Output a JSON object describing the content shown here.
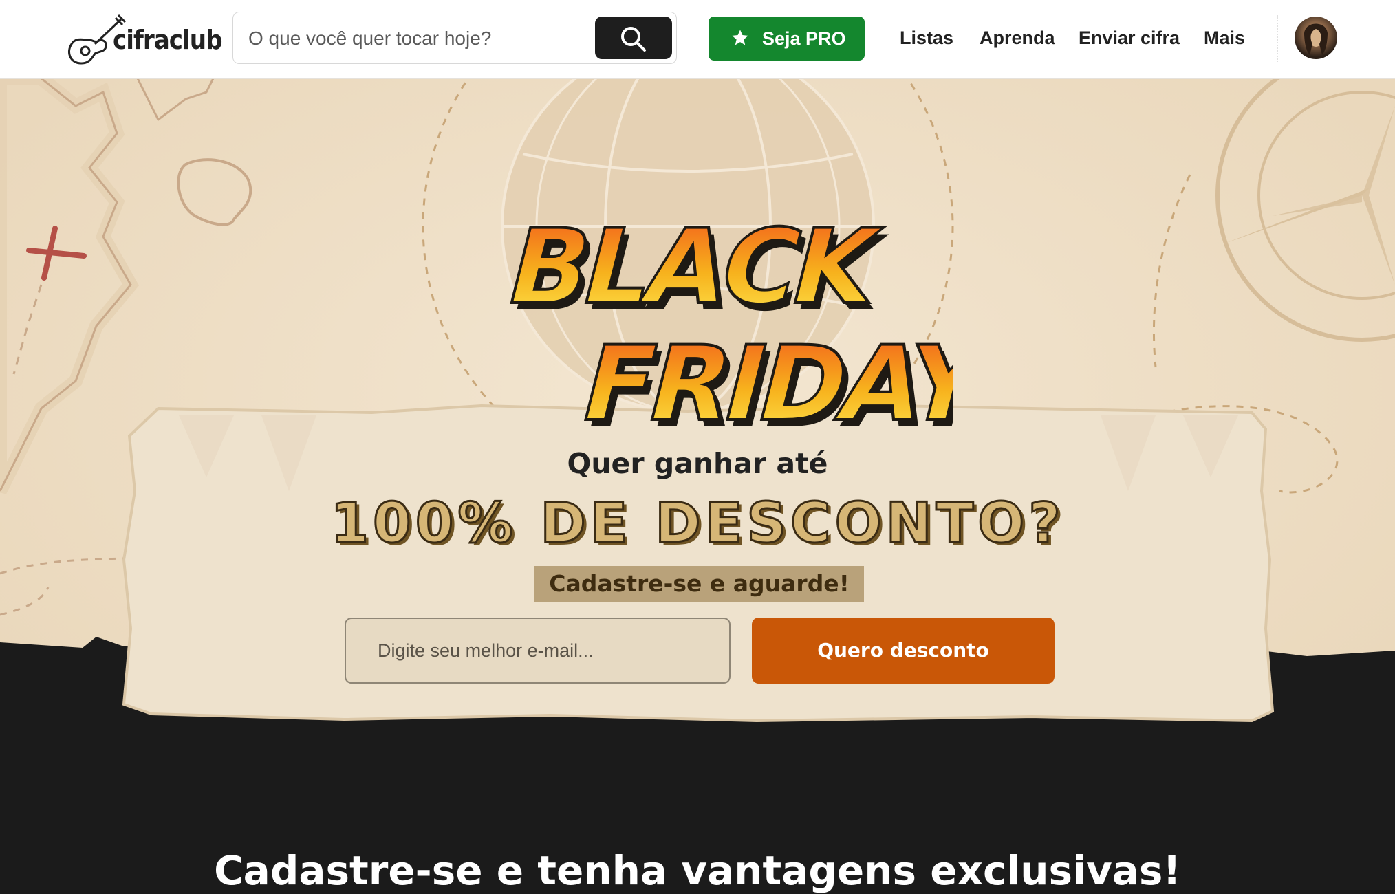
{
  "header": {
    "logo_text": "cifraclub",
    "search_placeholder": "O que você quer tocar hoje?",
    "pro_button": "Seja PRO",
    "nav": [
      "Listas",
      "Aprenda",
      "Enviar cifra",
      "Mais"
    ]
  },
  "hero": {
    "title_line1": "BLACK",
    "title_line2": "FRIDAY",
    "question": "Quer ganhar até",
    "headline": "100% DE DESCONTO?",
    "tagline": "Cadastre-se e aguarde!",
    "email_placeholder": "Digite seu melhor e-mail...",
    "cta_button": "Quero desconto"
  },
  "bottom": {
    "heading_partial": "Cadastre-se e tenha vantagens exclusivas!"
  },
  "colors": {
    "brand_green": "#14872e",
    "cta_orange": "#c95707",
    "parchment": "#efe3cf",
    "dark_section": "#1b1b1b"
  },
  "icons": [
    "guitar-logo-icon",
    "search-icon",
    "star-icon",
    "avatar"
  ]
}
